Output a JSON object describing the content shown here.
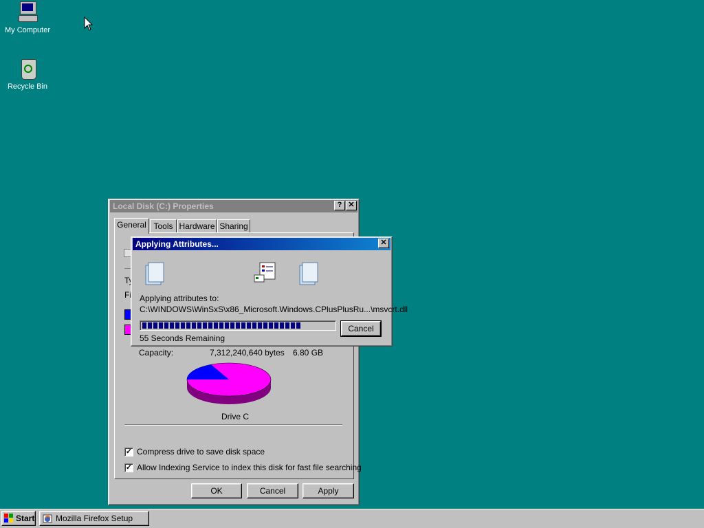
{
  "desktop": {
    "icons": [
      {
        "label": "My Computer",
        "icon": "my-computer-icon"
      },
      {
        "label": "Recycle Bin",
        "icon": "recycle-bin-icon"
      }
    ],
    "background_color": "#008080"
  },
  "properties_window": {
    "title": "Local Disk (C:) Properties",
    "help_glyph": "?",
    "close_glyph": "✕",
    "tabs": [
      "General",
      "Tools",
      "Hardware",
      "Sharing"
    ],
    "active_tab": "General",
    "partial_labels": {
      "type": "Ty",
      "filesystem": "Fi"
    },
    "capacity": {
      "label": "Capacity:",
      "bytes": "7,312,240,640 bytes",
      "size": "6.80 GB"
    },
    "pie": {
      "label": "Drive C",
      "used_fraction": 0.18,
      "used_color": "#0000ff",
      "free_color": "#ff00ff"
    },
    "checkboxes": [
      {
        "label": "Compress drive to save disk space",
        "checked": true
      },
      {
        "label": "Allow Indexing Service to index this disk for fast file searching",
        "checked": true
      }
    ],
    "buttons": {
      "ok": "OK",
      "cancel": "Cancel",
      "apply": "Apply"
    }
  },
  "dialog": {
    "title": "Applying Attributes...",
    "close_glyph": "✕",
    "applying_label": "Applying attributes to:",
    "path": "C:\\WINDOWS\\WinSxS\\x86_Microsoft.Windows.CPlusPlusRu...\\msvcrt.dll",
    "progress": 0.82,
    "remaining": "55 Seconds Remaining",
    "cancel_label": "Cancel"
  },
  "taskbar": {
    "start_label": "Start",
    "tasks": [
      {
        "label": "Mozilla Firefox Setup",
        "icon": "firefox-setup-icon"
      }
    ]
  }
}
